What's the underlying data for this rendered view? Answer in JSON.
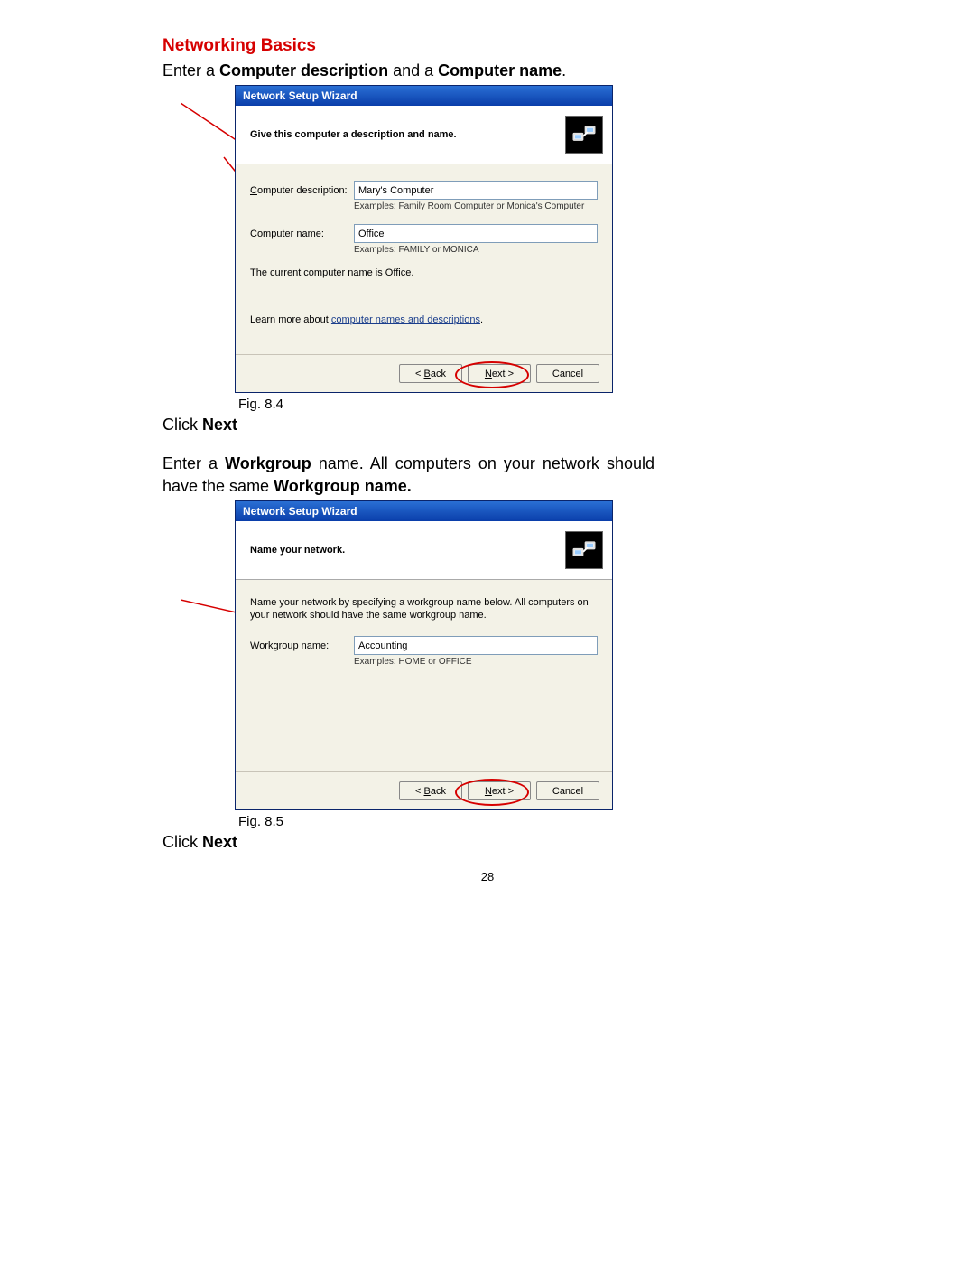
{
  "heading": "Networking Basics",
  "intro1_a": "Enter a ",
  "intro1_b": "Computer description",
  "intro1_c": " and a ",
  "intro1_d": "Computer name",
  "intro1_e": ".",
  "wiz1": {
    "title": "Network Setup Wizard",
    "header": "Give this computer a description and name.",
    "desc_label_pre": "C",
    "desc_label_rest": "omputer description:",
    "desc_value": "Mary's Computer",
    "desc_examples": "Examples: Family Room Computer or Monica's Computer",
    "name_label_a": "Computer n",
    "name_label_u": "a",
    "name_label_b": "me:",
    "name_value": "Office",
    "name_examples": "Examples: FAMILY or MONICA",
    "current_pre": "The current computer name is ",
    "current_val": "Office.",
    "learn_pre": "Learn more about ",
    "learn_link": "computer names and descriptions",
    "learn_post": ".",
    "back_pre": "< ",
    "back_u": "B",
    "back_post": "ack",
    "next_u": "N",
    "next_post": "ext >",
    "cancel": "Cancel"
  },
  "fig1": "Fig. 8.4",
  "click_next_a": "Click ",
  "click_next_b": "Next",
  "intro2_a": "Enter a ",
  "intro2_b": "Workgroup",
  "intro2_c": " name.  All computers on your network should have the same ",
  "intro2_d": "Workgroup name.",
  "wiz2": {
    "title": "Network Setup Wizard",
    "header": "Name your network.",
    "body_note": "Name your network by specifying a workgroup name below. All computers on your network should have the same workgroup name.",
    "wg_label_u": "W",
    "wg_label_rest": "orkgroup name:",
    "wg_value": "Accounting",
    "wg_examples": "Examples: HOME or OFFICE"
  },
  "fig2": "Fig. 8.5",
  "page_number": "28"
}
